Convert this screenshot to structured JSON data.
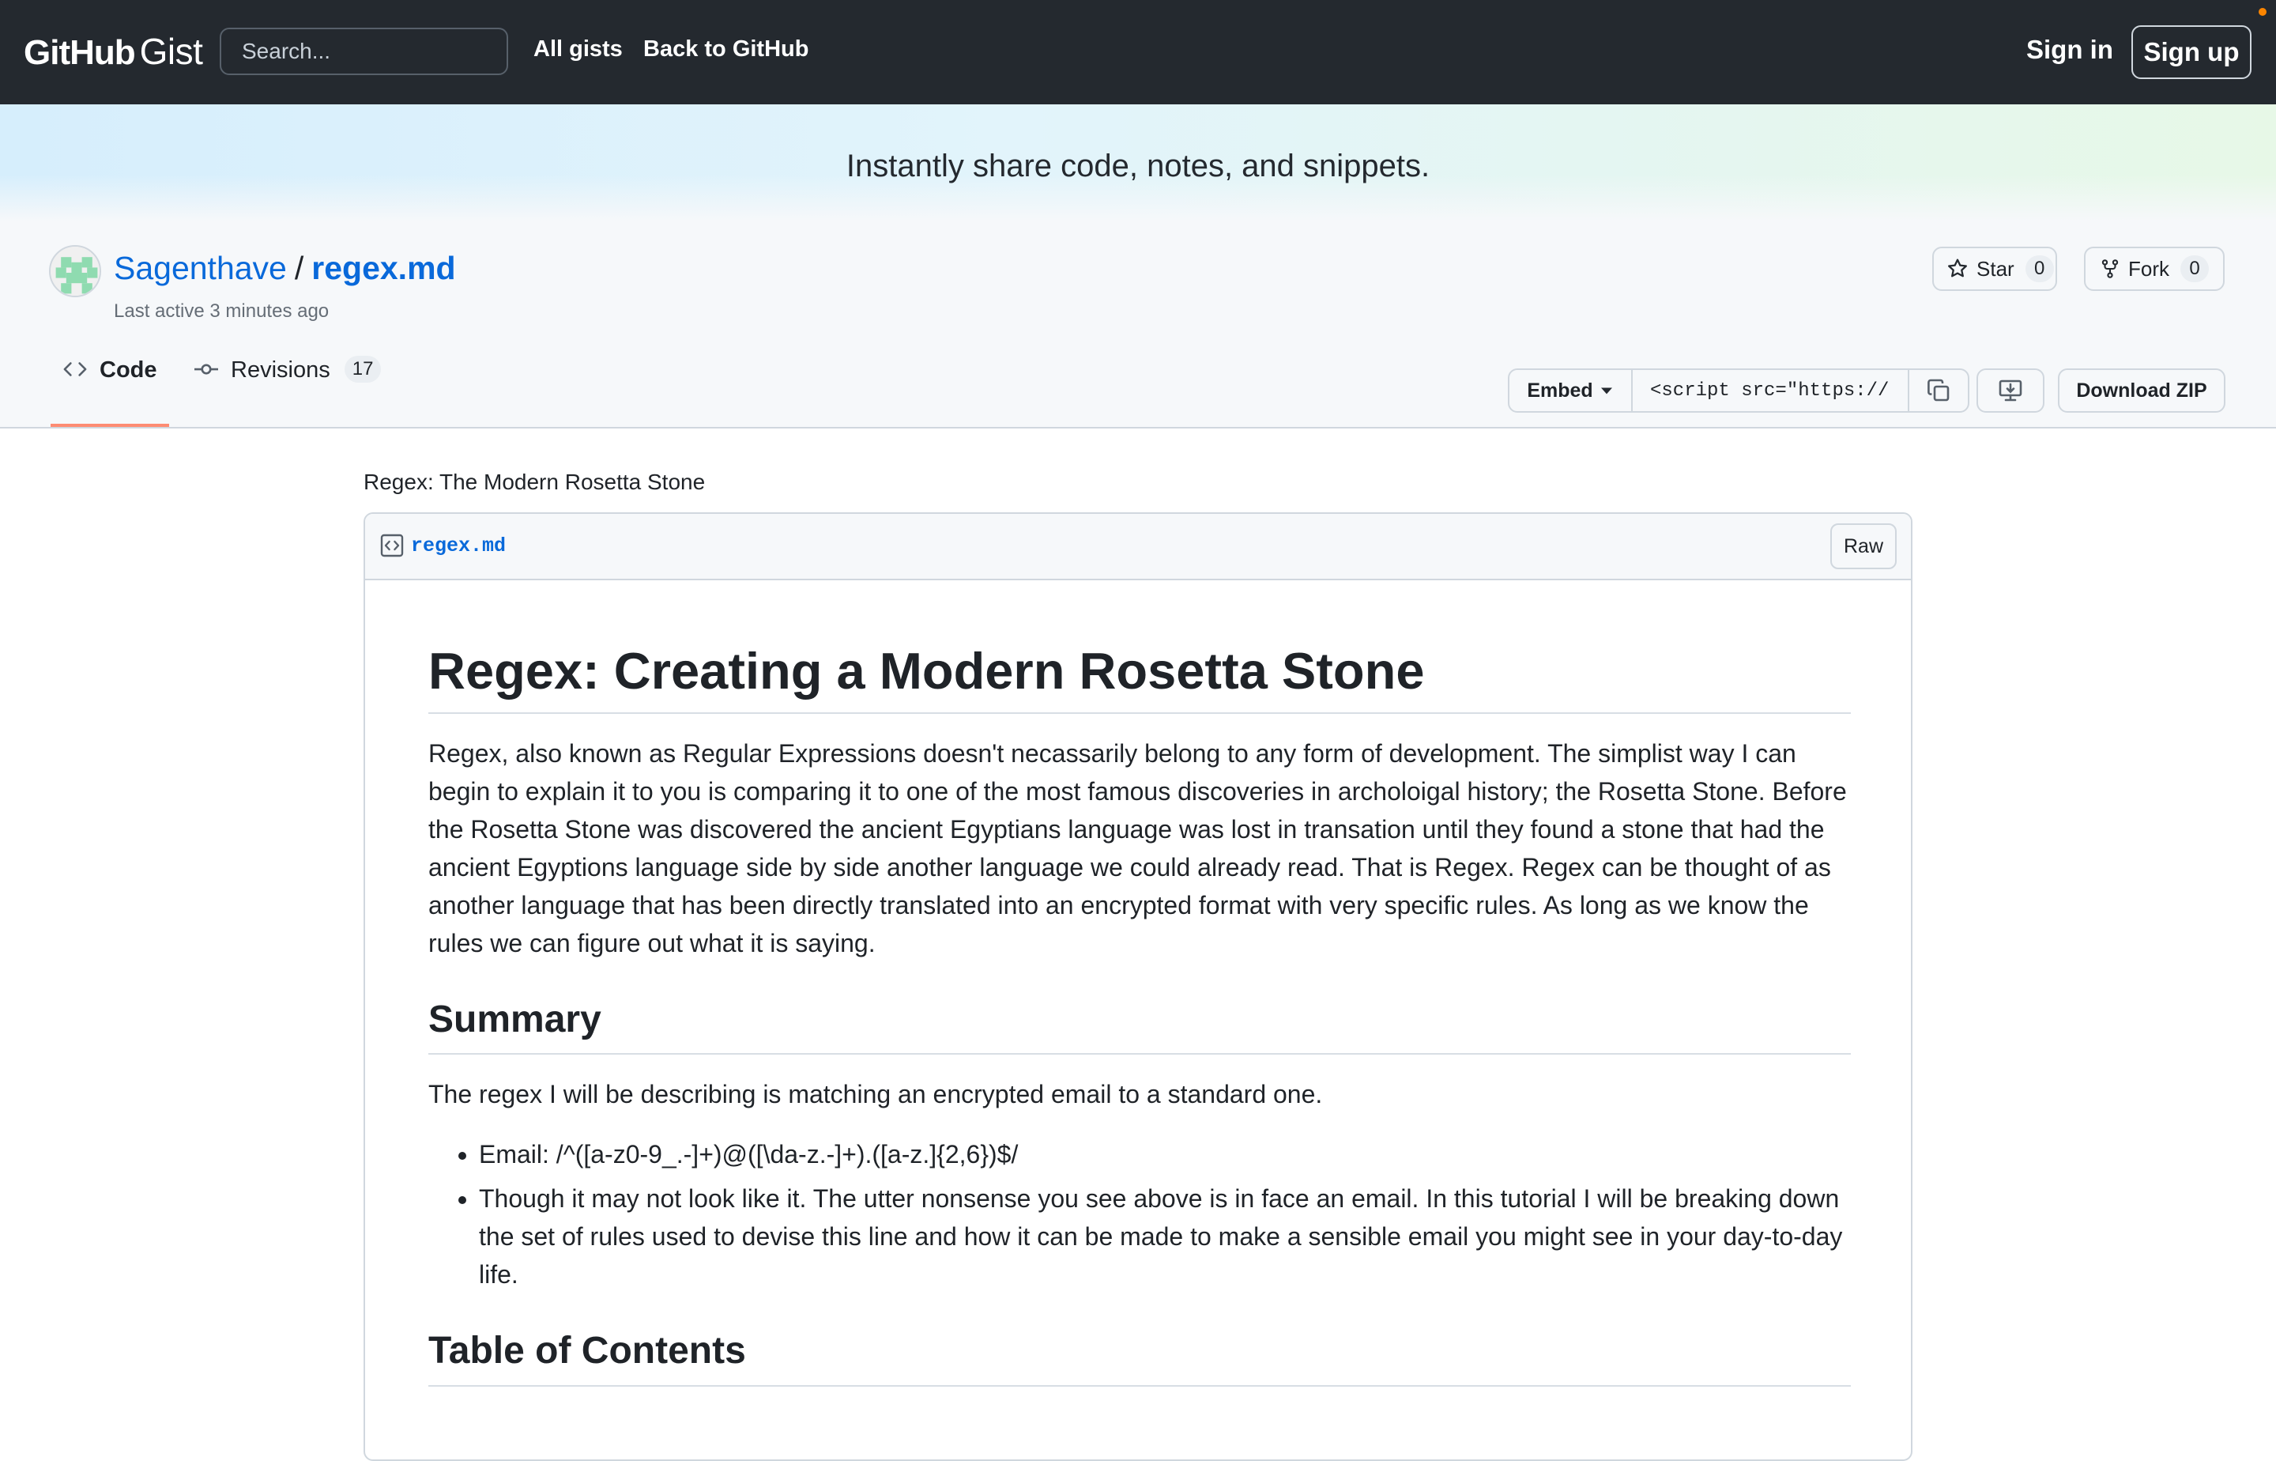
{
  "header": {
    "logo_github": "GitHub",
    "logo_gist": "Gist",
    "search_placeholder": "Search...",
    "nav": [
      "All gists",
      "Back to GitHub"
    ],
    "sign_in": "Sign in",
    "sign_up": "Sign up"
  },
  "banner": {
    "tagline": "Instantly share code, notes, and snippets."
  },
  "gist": {
    "owner": "Sagenthave",
    "separator": "/",
    "filename": "regex.md",
    "last_active": "Last active 3 minutes ago",
    "star_label": "Star",
    "star_count": "0",
    "fork_label": "Fork",
    "fork_count": "0"
  },
  "tabs": [
    {
      "label": "Code",
      "active": true
    },
    {
      "label": "Revisions",
      "count": "17"
    }
  ],
  "embed": {
    "label": "Embed",
    "value": "<script src=\"https://"
  },
  "download_zip": "Download ZIP",
  "file": {
    "description": "Regex: The Modern Rosetta Stone",
    "name": "regex.md",
    "raw": "Raw"
  },
  "content": {
    "h1": "Regex: Creating a Modern Rosetta Stone",
    "intro": "Regex, also known as Regular Expressions doesn't necassarily belong to any form of development. The simplist way I can begin to explain it to you is comparing it to one of the most famous discoveries in archoloigal history; the Rosetta Stone. Before the Rosetta Stone was discovered the ancient Egyptians language was lost in transation until they found a stone that had the ancient Egyptions language side by side another language we could already read. That is Regex. Regex can be thought of as another language that has been directly translated into an encrypted format with very specific rules. As long as we know the rules we can figure out what it is saying.",
    "summary_heading": "Summary",
    "summary_text": "The regex I will be describing is matching an encrypted email to a standard one.",
    "bullets": [
      "Email: /^([a-z0-9_.-]+)@([\\da-z.-]+).([a-z.]{2,6})$/",
      "Though it may not look like it. The utter nonsense you see above is in face an email. In this tutorial I will be breaking down the set of rules used to devise this line and how it can be made to make a sensible email you might see in your day-to-day life."
    ],
    "toc_heading": "Table of Contents"
  },
  "colors": {
    "header_bg": "#24292f",
    "link": "#0969da",
    "active_tab_underline": "#fd8c73"
  },
  "icons": [
    "star-icon",
    "fork-icon",
    "code-icon",
    "commit-icon",
    "caret-down-icon",
    "copy-icon",
    "desktop-download-icon",
    "file-code-icon"
  ]
}
